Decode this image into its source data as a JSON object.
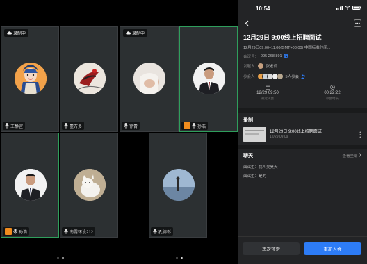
{
  "left": {
    "recording_label": "录制中",
    "tiles": [
      {
        "id": "t1",
        "name": "王静宜",
        "show_rec": true
      },
      {
        "id": "t2",
        "name": "董万多",
        "show_rec": false
      },
      {
        "id": "t3",
        "name": "徐青",
        "show_rec": true
      },
      {
        "id": "t4",
        "name": "孙浩",
        "show_rec": false
      },
      {
        "id": "t5",
        "name": "孙浩",
        "show_rec": false
      },
      {
        "id": "t6",
        "name": "南露环设212",
        "show_rec": false
      },
      {
        "id": "t7",
        "name": "孔德彰",
        "show_rec": false
      }
    ]
  },
  "right": {
    "status_time": "10:54",
    "title": "12月29日 9:00线上招聘面试",
    "subline": "12月29日09:00–11:00(GMT+08:00) 中国标准时间...",
    "meeting_id_label": "会议号：",
    "meeting_id": "995 268 891",
    "host_label": "发起人",
    "host_name": "张老师",
    "participants_label": "参会人",
    "participants_count": "5人参会",
    "stat1_value": "12/29 09:50",
    "stat1_caption": "最近入会",
    "stat2_value": "00:22:22",
    "stat2_caption": "参会时长",
    "recording_section": "录制",
    "recording_item_title": "12月29日 9:00线上招聘面试",
    "recording_item_date": "12/29 09:09",
    "chat_section": "聊天",
    "chat_see_all": "查看全部",
    "chat_line1": "面试生：我叫吴昊天",
    "chat_line2": "面试生：是的",
    "btn_reschedule": "再次预定",
    "btn_rejoin": "重新入会"
  },
  "colors": {
    "accent": "#2d7cf6",
    "tile_highlight": "#2f9e5c",
    "orange_badge": "#f08c1e"
  }
}
